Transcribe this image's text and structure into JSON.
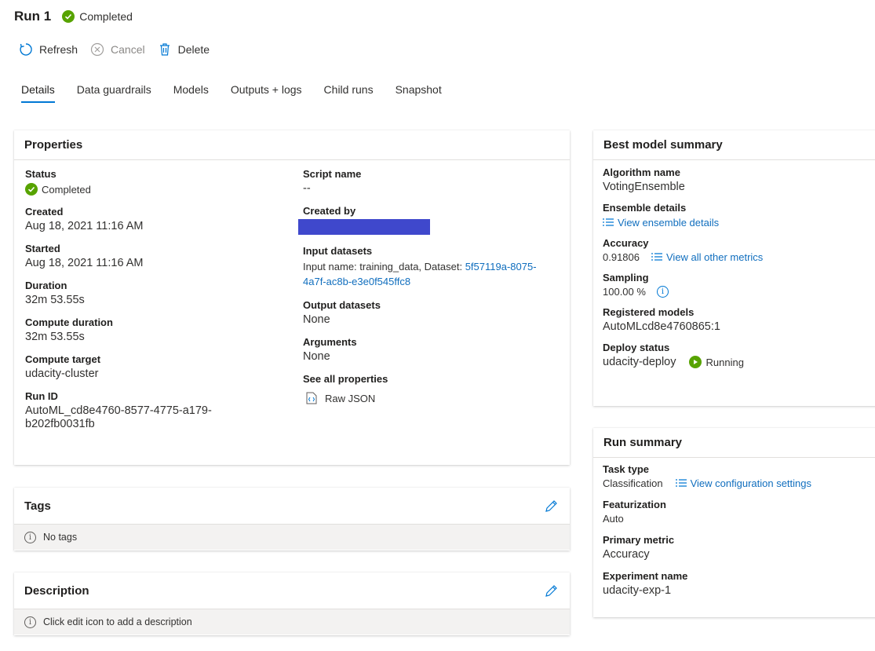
{
  "header": {
    "title": "Run 1",
    "status": "Completed"
  },
  "toolbar": {
    "refresh": "Refresh",
    "cancel": "Cancel",
    "delete": "Delete"
  },
  "tabs": [
    "Details",
    "Data guardrails",
    "Models",
    "Outputs + logs",
    "Child runs",
    "Snapshot"
  ],
  "properties": {
    "title": "Properties",
    "status_label": "Status",
    "status_value": "Completed",
    "created_label": "Created",
    "created_value": "Aug 18, 2021 11:16 AM",
    "started_label": "Started",
    "started_value": "Aug 18, 2021 11:16 AM",
    "duration_label": "Duration",
    "duration_value": "32m 53.55s",
    "compute_duration_label": "Compute duration",
    "compute_duration_value": "32m 53.55s",
    "compute_target_label": "Compute target",
    "compute_target_value": "udacity-cluster",
    "run_id_label": "Run ID",
    "run_id_line1": "AutoML_cd8e4760-8577-4775-a179-",
    "run_id_line2": "b202fb0031fb",
    "script_name_label": "Script name",
    "script_name_value": "--",
    "created_by_label": "Created by",
    "input_datasets_label": "Input datasets",
    "input_datasets_prefix": "Input name: training_data, Dataset: ",
    "input_datasets_link1": "5f57119a-8075-",
    "input_datasets_link2": "4a7f-ac8b-e3e0f545ffc8",
    "output_datasets_label": "Output datasets",
    "output_datasets_value": "None",
    "arguments_label": "Arguments",
    "arguments_value": "None",
    "see_all_label": "See all properties",
    "raw_json": "Raw JSON"
  },
  "tags": {
    "title": "Tags",
    "empty": "No tags"
  },
  "description": {
    "title": "Description",
    "hint": "Click edit icon to add a description"
  },
  "best_model": {
    "title": "Best model summary",
    "algorithm_label": "Algorithm name",
    "algorithm_value": "VotingEnsemble",
    "ensemble_label": "Ensemble details",
    "ensemble_link": "View ensemble details",
    "accuracy_label": "Accuracy",
    "accuracy_value": "0.91806",
    "metrics_link": "View all other metrics",
    "sampling_label": "Sampling",
    "sampling_value": "100.00 %",
    "registered_label": "Registered models",
    "registered_value": "AutoMLcd8e4760865:1",
    "deploy_label": "Deploy status",
    "deploy_value": "udacity-deploy",
    "deploy_state": "Running"
  },
  "run_summary": {
    "title": "Run summary",
    "task_label": "Task type",
    "task_value": "Classification",
    "config_link": "View configuration settings",
    "featurization_label": "Featurization",
    "featurization_value": "Auto",
    "primary_metric_label": "Primary metric",
    "primary_metric_value": "Accuracy",
    "experiment_label": "Experiment name",
    "experiment_value": "udacity-exp-1"
  },
  "colors": {
    "accent": "#0078d4",
    "link": "#106ebe",
    "success": "#57a300",
    "redaction": "#3f48cc"
  }
}
